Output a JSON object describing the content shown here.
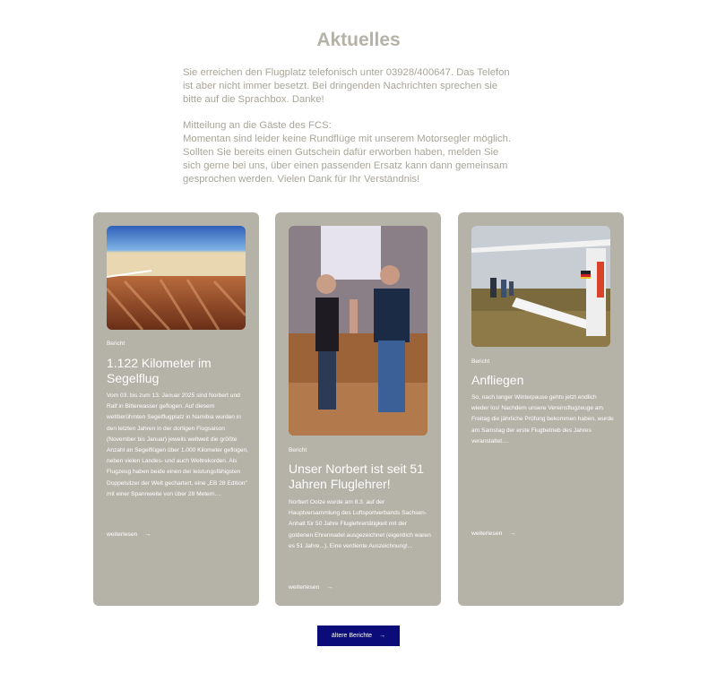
{
  "page": {
    "title": "Aktuelles",
    "intro": {
      "paragraph1": [
        "Sie erreichen den Flugplatz telefonisch unter 03928/400647. Das Telefon",
        "ist aber nicht immer besetzt. Bei dringenden Nachrichten sprechen sie",
        "bitte auf die Sprachbox. Danke!"
      ],
      "paragraph2": [
        "Mitteilung an die Gäste des FCS:",
        "Momentan sind leider keine Rundflüge mit unserem Motorsegler möglich.",
        "Sollten Sie bereits einen Gutschein dafür erworben haben, melden Sie",
        "sich gerne bei uns, über einen passenden Ersatz kann dann gemeinsam",
        "gesprochen werden. Vielen Dank für Ihr Verständnis!"
      ]
    }
  },
  "posts": [
    {
      "category": "Bericht",
      "title": "1.122 Kilometer im Segelflug",
      "excerpt": "Vom 03. bis zum 13. Januar 2025 sind Norbert und Ralf in Bitterwasser geflogen. Auf diesem weltberühmten Segelflugplatz in Namibia wurden in den letzten Jahren in der dortigen Flugsaison (November bis Januar) jeweils weltweit die größte Anzahl an Segelflügen über 1.000 Kilometer geflogen, neben vielen Landes- und auch Weltrekorden. Als Flugzeug haben beide einen der leistungsfähigsten Doppelsitzer der Welt gechartert, eine „EB 28 Edition\" mit einer Spannweite von über 28 Metern....",
      "read_more": "weiterlesen",
      "image_icon": "glider-over-desert-photo"
    },
    {
      "category": "Bericht",
      "title": "Unser Norbert ist seit 51 Jahren Fluglehrer!",
      "excerpt": "Norbert Oolze wurde am 8.3. auf der Hauptversammlung des Luftsportverbands Sachsen-Anhalt für 50 Jahre Fluglehrertätigkeit mit der goldenen Ehrennadel ausgezeichnet (eigentlich waren es 51 Jahre...). Eine verdiente Auszeichnung!...",
      "read_more": "weiterlesen",
      "image_icon": "award-ceremony-photo"
    },
    {
      "category": "Bericht",
      "title": "Anfliegen",
      "excerpt": "So, nach langer Winterpause gehts jetzt endlich wieder los! Nachdem unsere Vereinsflugzeuge am Freitag die jährliche Prüfung bekommen haben, wurde am Samstag der erste Flugbetrieb des Jahres veranstaltet....",
      "read_more": "weiterlesen",
      "image_icon": "glider-on-airfield-photo"
    }
  ],
  "older_button": {
    "label": "ältere Berichte",
    "icon": "arrow-right-icon"
  },
  "colors": {
    "card_bg": "#b5b2a7",
    "text_muted": "#a8a598",
    "button_bg": "#0b0b7a"
  }
}
